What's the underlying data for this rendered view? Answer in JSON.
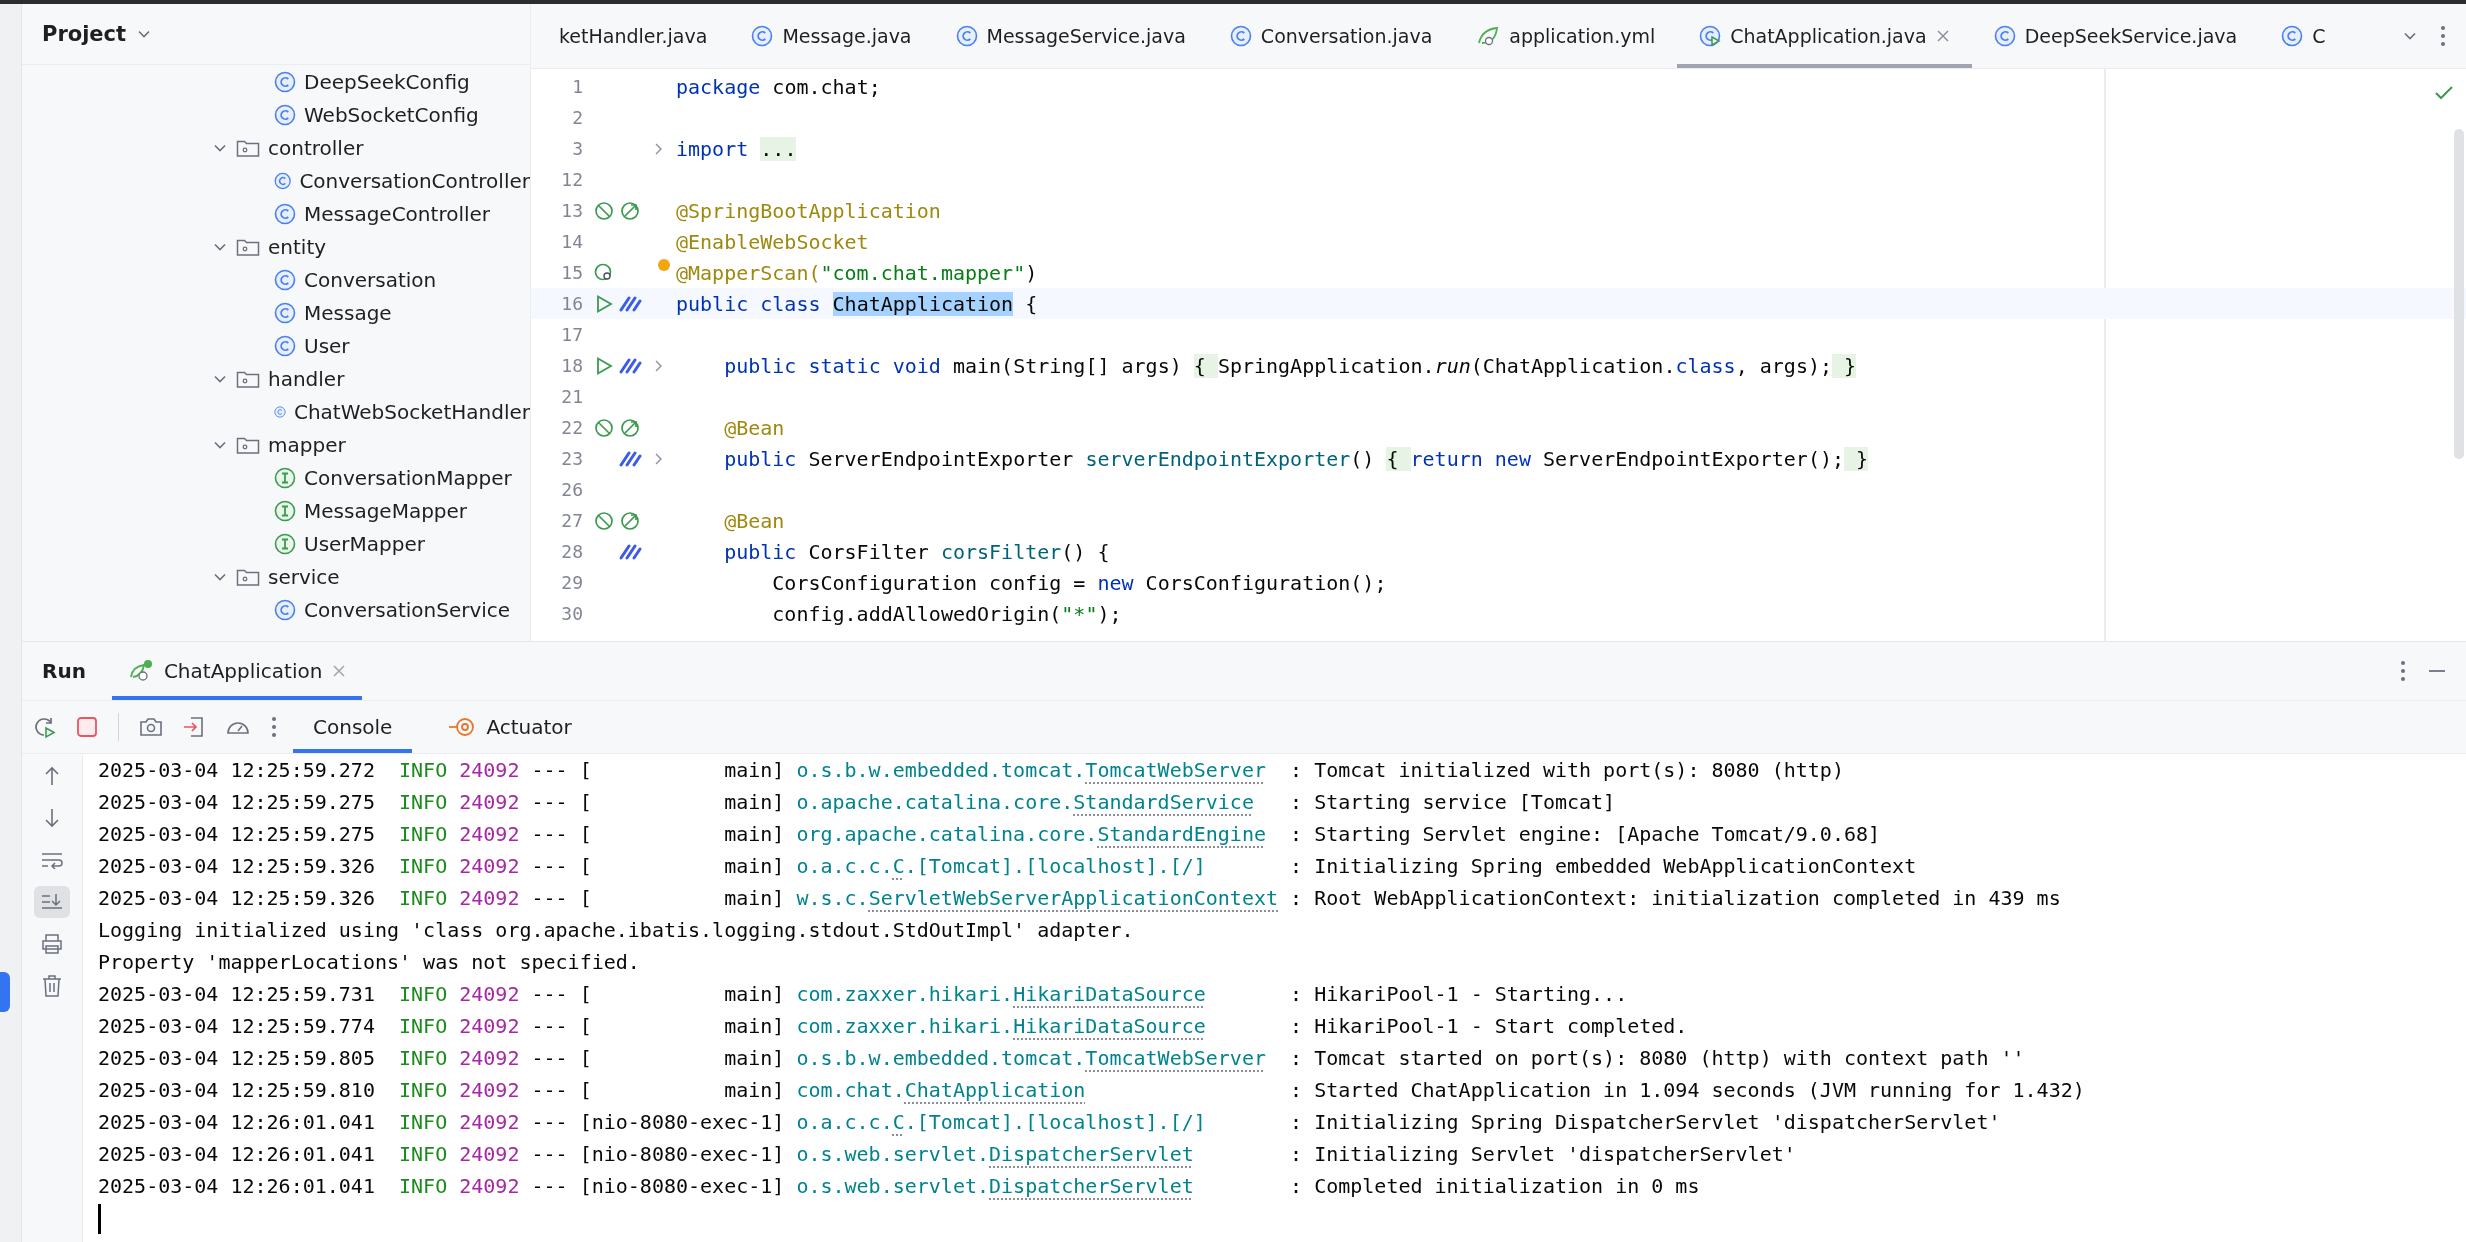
{
  "project": {
    "title": "Project",
    "cut_children": [
      {
        "name": "DeepSeekConfig",
        "kind": "class"
      },
      {
        "name": "WebSocketConfig",
        "kind": "class"
      }
    ],
    "tree": [
      {
        "name": "controller",
        "kind": "package",
        "expanded": true,
        "children": [
          {
            "name": "ConversationController",
            "kind": "class"
          },
          {
            "name": "MessageController",
            "kind": "class"
          }
        ]
      },
      {
        "name": "entity",
        "kind": "package",
        "expanded": true,
        "children": [
          {
            "name": "Conversation",
            "kind": "class"
          },
          {
            "name": "Message",
            "kind": "class"
          },
          {
            "name": "User",
            "kind": "class"
          }
        ]
      },
      {
        "name": "handler",
        "kind": "package",
        "expanded": true,
        "children": [
          {
            "name": "ChatWebSocketHandler",
            "kind": "class"
          }
        ]
      },
      {
        "name": "mapper",
        "kind": "package",
        "expanded": true,
        "children": [
          {
            "name": "ConversationMapper",
            "kind": "interface"
          },
          {
            "name": "MessageMapper",
            "kind": "interface"
          },
          {
            "name": "UserMapper",
            "kind": "interface"
          }
        ]
      },
      {
        "name": "service",
        "kind": "package",
        "expanded": true,
        "children": [
          {
            "name": "ConversationService",
            "kind": "class"
          }
        ]
      }
    ]
  },
  "editor_tabs": [
    {
      "label": "ketHandler.java",
      "kind": "cut",
      "selected": false
    },
    {
      "label": "Message.java",
      "kind": "class",
      "selected": false
    },
    {
      "label": "MessageService.java",
      "kind": "class",
      "selected": false
    },
    {
      "label": "Conversation.java",
      "kind": "class",
      "selected": false
    },
    {
      "label": "application.yml",
      "kind": "yml",
      "selected": false
    },
    {
      "label": "ChatApplication.java",
      "kind": "spring",
      "selected": true
    },
    {
      "label": "DeepSeekService.java",
      "kind": "class",
      "selected": false
    },
    {
      "label": "C",
      "kind": "class",
      "selected": false
    }
  ],
  "code_lines": [
    {
      "number": "1",
      "fold": false,
      "current": false,
      "bulb": false,
      "tokens": [
        {
          "text": "package",
          "kind": "kw"
        },
        {
          "text": " com.chat;",
          "kind": "plain"
        }
      ]
    },
    {
      "number": "2",
      "fold": false,
      "current": false,
      "bulb": false
    },
    {
      "number": "3",
      "fold": true,
      "current": false,
      "bulb": false,
      "tokens": [
        {
          "text": "import ",
          "kind": "kw"
        },
        {
          "text": "...",
          "kind": "folded"
        }
      ]
    },
    {
      "number": "12",
      "fold": false,
      "current": false,
      "bulb": false
    },
    {
      "number": "13",
      "gutter": [
        {
          "kind": "bean-off"
        },
        {
          "kind": "bean-nav"
        }
      ],
      "fold": false,
      "current": false,
      "bulb": false,
      "tokens": [
        {
          "text": "@SpringBootApplication",
          "kind": "annotation"
        }
      ]
    },
    {
      "number": "14",
      "fold": false,
      "current": false,
      "bulb": false,
      "tokens": [
        {
          "text": "@EnableWebSocket",
          "kind": "annotation"
        }
      ]
    },
    {
      "number": "15",
      "gutter": [
        {
          "kind": "bean-scan"
        }
      ],
      "fold": false,
      "current": false,
      "bulb": true,
      "tokens": [
        {
          "text": "@MapperScan(",
          "kind": "annotation"
        },
        {
          "text": "\"com.chat.mapper\"",
          "kind": "string"
        },
        {
          "text": ")",
          "kind": "plain"
        }
      ]
    },
    {
      "number": "16",
      "gutter": [
        {
          "kind": "run"
        },
        {
          "kind": "spring"
        }
      ],
      "fold": false,
      "current": true,
      "bulb": false,
      "tokens": [
        {
          "text": "public class ",
          "kind": "kw"
        },
        {
          "text": "ChatApplication",
          "kind": "selection"
        },
        {
          "text": " {",
          "kind": "plain"
        }
      ]
    },
    {
      "number": "17",
      "fold": false,
      "current": false,
      "bulb": false
    },
    {
      "number": "18",
      "gutter": [
        {
          "kind": "run"
        },
        {
          "kind": "spring"
        }
      ],
      "fold": true,
      "current": false,
      "bulb": false,
      "tokens": [
        {
          "text": "    public static void ",
          "kind": "kw"
        },
        {
          "text": "main(String[] args) ",
          "kind": "plain"
        },
        {
          "text": "{ ",
          "kind": "folded"
        },
        {
          "text": "SpringApplication.",
          "kind": "plain"
        },
        {
          "text": "run",
          "kind": "italic"
        },
        {
          "text": "(ChatApplication.",
          "kind": "plain"
        },
        {
          "text": "class",
          "kind": "kw"
        },
        {
          "text": ", args);",
          "kind": "plain"
        },
        {
          "text": " }",
          "kind": "folded"
        }
      ]
    },
    {
      "number": "21",
      "fold": false,
      "current": false,
      "bulb": false
    },
    {
      "number": "22",
      "gutter": [
        {
          "kind": "bean-off"
        },
        {
          "kind": "bean-nav"
        }
      ],
      "fold": false,
      "current": false,
      "bulb": false,
      "tokens": [
        {
          "text": "    @Bean",
          "kind": "annotation"
        }
      ]
    },
    {
      "number": "23",
      "gutter": [
        {
          "kind": "none"
        },
        {
          "kind": "spring"
        }
      ],
      "fold": true,
      "current": false,
      "bulb": false,
      "tokens": [
        {
          "text": "    public ",
          "kind": "kw"
        },
        {
          "text": "ServerEndpointExporter ",
          "kind": "plain"
        },
        {
          "text": "serverEndpointExporter",
          "kind": "method"
        },
        {
          "text": "() ",
          "kind": "plain"
        },
        {
          "text": "{ ",
          "kind": "folded"
        },
        {
          "text": "return new ",
          "kind": "kw"
        },
        {
          "text": "ServerEndpointExporter();",
          "kind": "plain"
        },
        {
          "text": " }",
          "kind": "folded"
        }
      ]
    },
    {
      "number": "26",
      "fold": false,
      "current": false,
      "bulb": false
    },
    {
      "number": "27",
      "gutter": [
        {
          "kind": "bean-off"
        },
        {
          "kind": "bean-nav"
        }
      ],
      "fold": false,
      "current": false,
      "bulb": false,
      "tokens": [
        {
          "text": "    @Bean",
          "kind": "annotation"
        }
      ]
    },
    {
      "number": "28",
      "gutter": [
        {
          "kind": "none"
        },
        {
          "kind": "spring"
        }
      ],
      "fold": false,
      "current": false,
      "bulb": false,
      "tokens": [
        {
          "text": "    public ",
          "kind": "kw"
        },
        {
          "text": "CorsFilter ",
          "kind": "plain"
        },
        {
          "text": "corsFilter",
          "kind": "method"
        },
        {
          "text": "() {",
          "kind": "plain"
        }
      ]
    },
    {
      "number": "29",
      "fold": false,
      "current": false,
      "bulb": false,
      "tokens": [
        {
          "text": "        CorsConfiguration config = ",
          "kind": "plain"
        },
        {
          "text": "new ",
          "kind": "kw"
        },
        {
          "text": "CorsConfiguration();",
          "kind": "plain"
        }
      ]
    },
    {
      "number": "30",
      "fold": false,
      "current": false,
      "bulb": false,
      "tokens": [
        {
          "text": "        config.addAllowedOrigin(",
          "kind": "plain"
        },
        {
          "text": "\"*\"",
          "kind": "string"
        },
        {
          "text": ");",
          "kind": "plain"
        }
      ]
    }
  ],
  "run_panel": {
    "title": "Run",
    "tabs": [
      {
        "label": "ChatApplication",
        "selected": true
      }
    ],
    "tool_tabs": [
      {
        "label": "Console",
        "kind": "console",
        "selected": true
      },
      {
        "label": "Actuator",
        "kind": "actuator",
        "selected": false
      }
    ],
    "scroll_to_end": true,
    "console": [
      {
        "kind": "log",
        "time": "2025-03-04 12:25:59.272",
        "level": "INFO",
        "pid": "24092",
        "sep": "---",
        "thread": "[           main]",
        "logger_pre": "o.s.b.w.embedded.tomcat.",
        "logger_link": "TomcatWebServer",
        "message": ": Tomcat initialized with port(s): 8080 (http)"
      },
      {
        "kind": "log",
        "time": "2025-03-04 12:25:59.275",
        "level": "INFO",
        "pid": "24092",
        "sep": "---",
        "thread": "[           main]",
        "logger_pre": "o.apache.catalina.core.",
        "logger_link": "StandardService",
        "message": ": Starting service [Tomcat]"
      },
      {
        "kind": "log",
        "time": "2025-03-04 12:25:59.275",
        "level": "INFO",
        "pid": "24092",
        "sep": "---",
        "thread": "[           main]",
        "logger_pre": "org.apache.catalina.core.",
        "logger_link": "StandardEngine",
        "message": ": Starting Servlet engine: [Apache Tomcat/9.0.68]"
      },
      {
        "kind": "log",
        "time": "2025-03-04 12:25:59.326",
        "level": "INFO",
        "pid": "24092",
        "sep": "---",
        "thread": "[           main]",
        "logger_pre": "o.a.c.c.",
        "logger_link": "C",
        "logger_post": ".[Tomcat].[localhost].[/]",
        "message": ": Initializing Spring embedded WebApplicationContext"
      },
      {
        "kind": "log",
        "time": "2025-03-04 12:25:59.326",
        "level": "INFO",
        "pid": "24092",
        "sep": "---",
        "thread": "[           main]",
        "logger_pre": "w.s.c.",
        "logger_link": "ServletWebServerApplicationContext",
        "message": ": Root WebApplicationContext: initialization completed in 439 ms"
      },
      {
        "kind": "text",
        "text": "Logging initialized using 'class org.apache.ibatis.logging.stdout.StdOutImpl' adapter."
      },
      {
        "kind": "text",
        "text": "Property 'mapperLocations' was not specified."
      },
      {
        "kind": "log",
        "time": "2025-03-04 12:25:59.731",
        "level": "INFO",
        "pid": "24092",
        "sep": "---",
        "thread": "[           main]",
        "logger_pre": "com.zaxxer.hikari.",
        "logger_link": "HikariDataSource",
        "message": ": HikariPool-1 - Starting..."
      },
      {
        "kind": "log",
        "time": "2025-03-04 12:25:59.774",
        "level": "INFO",
        "pid": "24092",
        "sep": "---",
        "thread": "[           main]",
        "logger_pre": "com.zaxxer.hikari.",
        "logger_link": "HikariDataSource",
        "message": ": HikariPool-1 - Start completed."
      },
      {
        "kind": "log",
        "time": "2025-03-04 12:25:59.805",
        "level": "INFO",
        "pid": "24092",
        "sep": "---",
        "thread": "[           main]",
        "logger_pre": "o.s.b.w.embedded.tomcat.",
        "logger_link": "TomcatWebServer",
        "message": ": Tomcat started on port(s): 8080 (http) with context path ''"
      },
      {
        "kind": "log",
        "time": "2025-03-04 12:25:59.810",
        "level": "INFO",
        "pid": "24092",
        "sep": "---",
        "thread": "[           main]",
        "logger_pre": "com.chat.",
        "logger_link": "ChatApplication",
        "message": ": Started ChatApplication in 1.094 seconds (JVM running for 1.432)"
      },
      {
        "kind": "log",
        "time": "2025-03-04 12:26:01.041",
        "level": "INFO",
        "pid": "24092",
        "sep": "---",
        "thread": "[nio-8080-exec-1]",
        "logger_pre": "o.a.c.c.",
        "logger_link": "C",
        "logger_post": ".[Tomcat].[localhost].[/]",
        "message": ": Initializing Spring DispatcherServlet 'dispatcherServlet'"
      },
      {
        "kind": "log",
        "time": "2025-03-04 12:26:01.041",
        "level": "INFO",
        "pid": "24092",
        "sep": "---",
        "thread": "[nio-8080-exec-1]",
        "logger_pre": "o.s.web.servlet.",
        "logger_link": "DispatcherServlet",
        "message": ": Initializing Servlet 'dispatcherServlet'"
      },
      {
        "kind": "log",
        "time": "2025-03-04 12:26:01.041",
        "level": "INFO",
        "pid": "24092",
        "sep": "---",
        "thread": "[nio-8080-exec-1]",
        "logger_pre": "o.s.web.servlet.",
        "logger_link": "DispatcherServlet",
        "message": ": Completed initialization in 0 ms"
      }
    ]
  }
}
